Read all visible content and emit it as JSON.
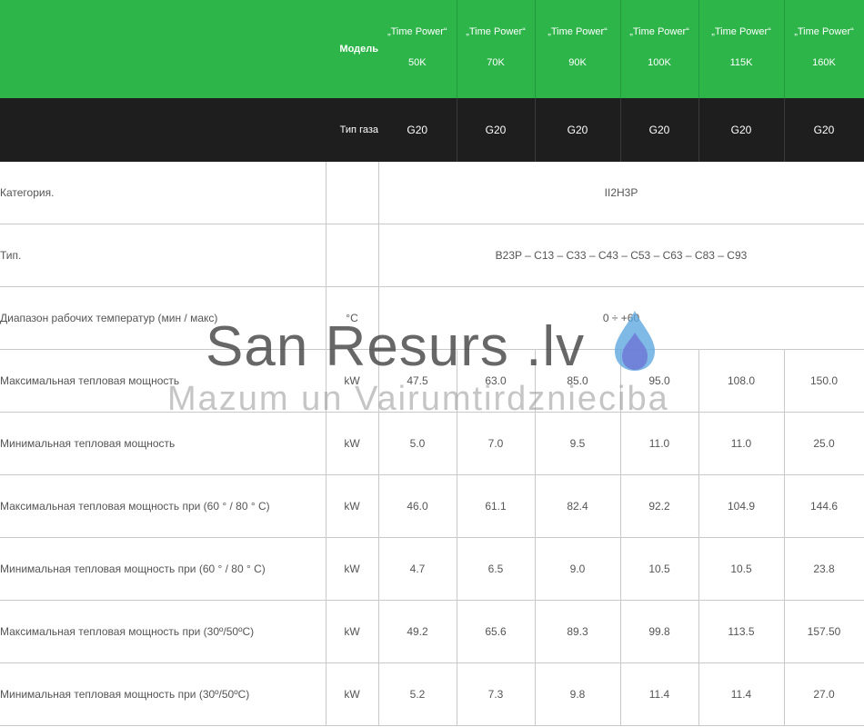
{
  "header": {
    "model_label": "Модель",
    "gas_label": "Тип газа",
    "models": [
      {
        "name": "„Time Power“",
        "size": "50K",
        "gas": "G20"
      },
      {
        "name": "„Time Power“",
        "size": "70K",
        "gas": "G20"
      },
      {
        "name": "„Time Power“",
        "size": "90K",
        "gas": "G20"
      },
      {
        "name": "„Time Power“",
        "size": "100K",
        "gas": "G20"
      },
      {
        "name": "„Time Power“",
        "size": "115K",
        "gas": "G20"
      },
      {
        "name": "„Time Power“",
        "size": "160K",
        "gas": "G20"
      }
    ]
  },
  "rows": [
    {
      "label": "Категория.",
      "unit": "",
      "span_value": "II2H3P"
    },
    {
      "label": "Тип.",
      "unit": "",
      "span_value": "B23P – C13 – C33 – C43 – C53 – C63 – C83 – C93"
    },
    {
      "label": "Диапазон рабочих температур (мин / макс)",
      "unit": "°C",
      "span_value": "0 ÷ +60"
    },
    {
      "label": "Максимальная тепловая мощность",
      "unit": "kW",
      "values": [
        "47.5",
        "63.0",
        "85.0",
        "95.0",
        "108.0",
        "150.0"
      ]
    },
    {
      "label": "Минимальная тепловая мощность",
      "unit": "kW",
      "values": [
        "5.0",
        "7.0",
        "9.5",
        "11.0",
        "11.0",
        "25.0"
      ]
    },
    {
      "label": "Максимальная тепловая мощность при (60 ° / 80 ° C)",
      "unit": "kW",
      "values": [
        "46.0",
        "61.1",
        "82.4",
        "92.2",
        "104.9",
        "144.6"
      ]
    },
    {
      "label": "Минимальная тепловая мощность при (60 ° / 80 ° C)",
      "unit": "kW",
      "values": [
        "4.7",
        "6.5",
        "9.0",
        "10.5",
        "10.5",
        "23.8"
      ]
    },
    {
      "label": "Максимальная тепловая мощность при (30º/50ºC)",
      "unit": "kW",
      "values": [
        "49.2",
        "65.6",
        "89.3",
        "99.8",
        "113.5",
        "157.50"
      ]
    },
    {
      "label": "Минимальная тепловая мощность при (30º/50ºC)",
      "unit": "kW",
      "values": [
        "5.2",
        "7.3",
        "9.8",
        "11.4",
        "11.4",
        "27.0"
      ]
    }
  ],
  "watermark": {
    "title": "San Resurs .lv",
    "subtitle": "Mazum un Vairumtirdznieciba",
    "icon": "water-drop-icon"
  },
  "colors": {
    "header_green": "#2db54a",
    "header_dark": "#1e1e1e"
  }
}
